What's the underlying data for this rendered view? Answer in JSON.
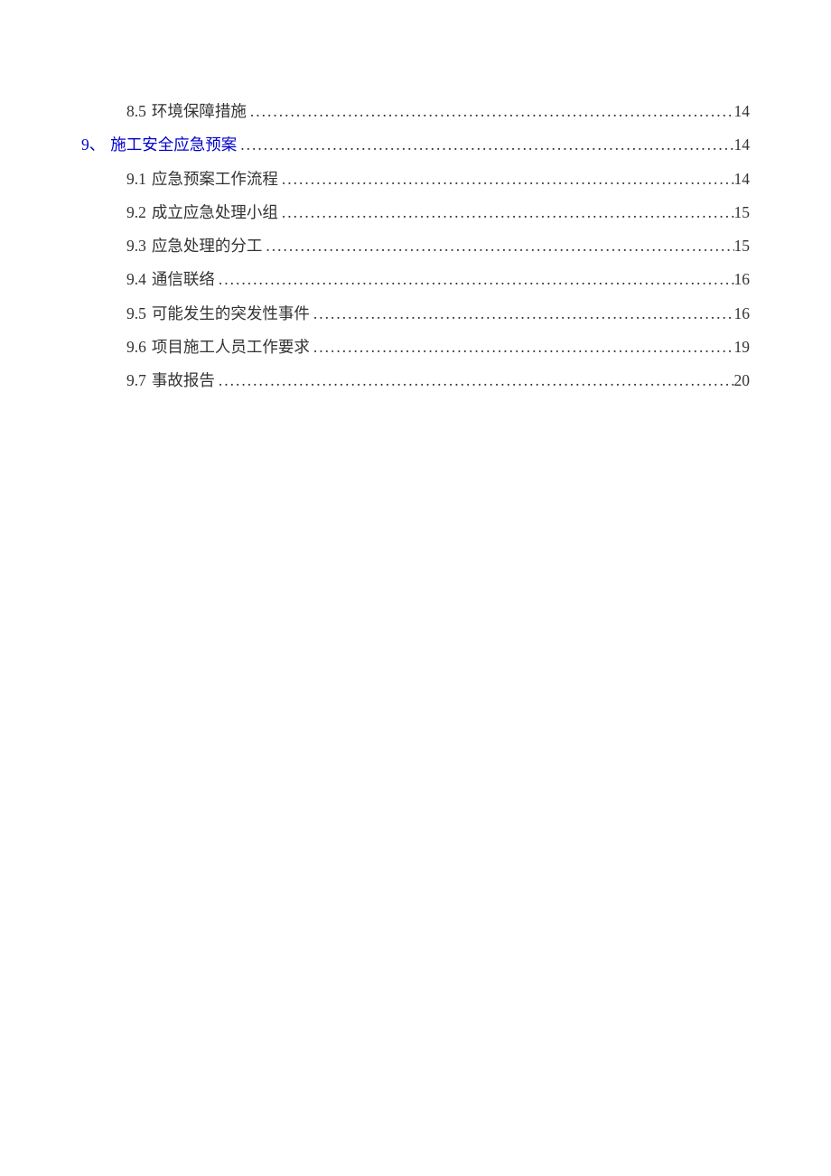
{
  "toc": {
    "entries": [
      {
        "level": 2,
        "number": "8.5",
        "title": "环境保障措施",
        "page": "14",
        "link": false
      },
      {
        "level": 1,
        "number": "9、",
        "title": "施工安全应急预案",
        "page": "14",
        "link": true
      },
      {
        "level": 2,
        "number": "9.1",
        "title": "应急预案工作流程",
        "page": "14",
        "link": false
      },
      {
        "level": 2,
        "number": "9.2",
        "title": "成立应急处理小组",
        "page": "15",
        "link": false
      },
      {
        "level": 2,
        "number": "9.3",
        "title": "应急处理的分工",
        "page": "15",
        "link": false
      },
      {
        "level": 2,
        "number": "9.4",
        "title": "通信联络",
        "page": "16",
        "link": false
      },
      {
        "level": 2,
        "number": "9.5",
        "title": "可能发生的突发性事件",
        "page": "16",
        "link": false
      },
      {
        "level": 2,
        "number": "9.6",
        "title": "项目施工人员工作要求",
        "page": "19",
        "link": false
      },
      {
        "level": 2,
        "number": "9.7",
        "title": "事故报告",
        "page": "20",
        "link": false
      }
    ]
  }
}
